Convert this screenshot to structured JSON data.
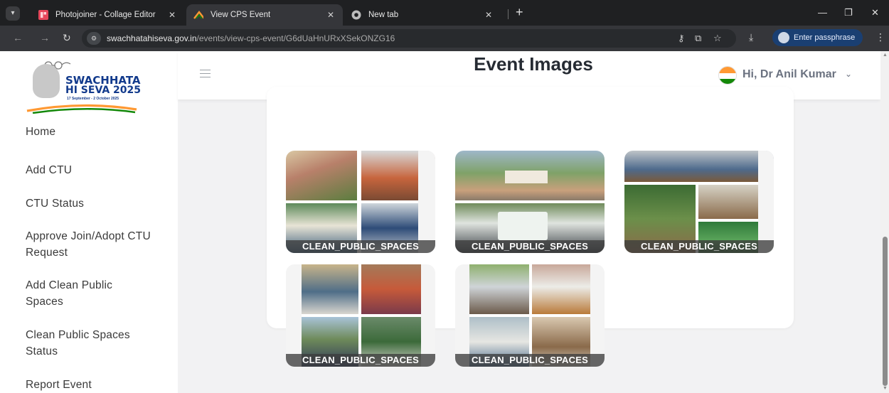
{
  "browser": {
    "tabs": [
      {
        "title": "Photojoiner - Collage Editor",
        "favicon": "photojoiner-icon",
        "active": false
      },
      {
        "title": "View CPS Event",
        "favicon": "swachh-logo-icon",
        "active": true
      },
      {
        "title": "New tab",
        "favicon": "chrome-icon",
        "active": false
      }
    ],
    "url_host": "swachhatahiseva.gov.in",
    "url_path": "/events/view-cps-event/G6dUaHnURxXSekONZG16",
    "passphrase_label": "Enter passphrase"
  },
  "sidebar": {
    "logo_line1": "SWACHHATA",
    "logo_line2": "HI SEVA 2025",
    "logo_sub": "17 September - 2 October 2025",
    "items": [
      {
        "label": "Home"
      },
      {
        "label": "Add CTU"
      },
      {
        "label": "CTU Status"
      },
      {
        "label": "Approve Join/Adopt CTU Request"
      },
      {
        "label": "Add Clean Public Spaces"
      },
      {
        "label": "Clean Public Spaces Status"
      },
      {
        "label": "Report Event"
      }
    ]
  },
  "header": {
    "greeting": "Hi, Dr Anil Kumar"
  },
  "main": {
    "section_title": "Event Images",
    "images": [
      {
        "label": "CLEAN_PUBLIC_SPACES"
      },
      {
        "label": "CLEAN_PUBLIC_SPACES"
      },
      {
        "label": "CLEAN_PUBLIC_SPACES"
      },
      {
        "label": "CLEAN_PUBLIC_SPACES"
      },
      {
        "label": "CLEAN_PUBLIC_SPACES"
      }
    ]
  },
  "colors": {
    "brand_blue": "#123a8c",
    "saffron": "#ff9933",
    "green": "#138808",
    "label_overlay": "#3c3c3c"
  }
}
